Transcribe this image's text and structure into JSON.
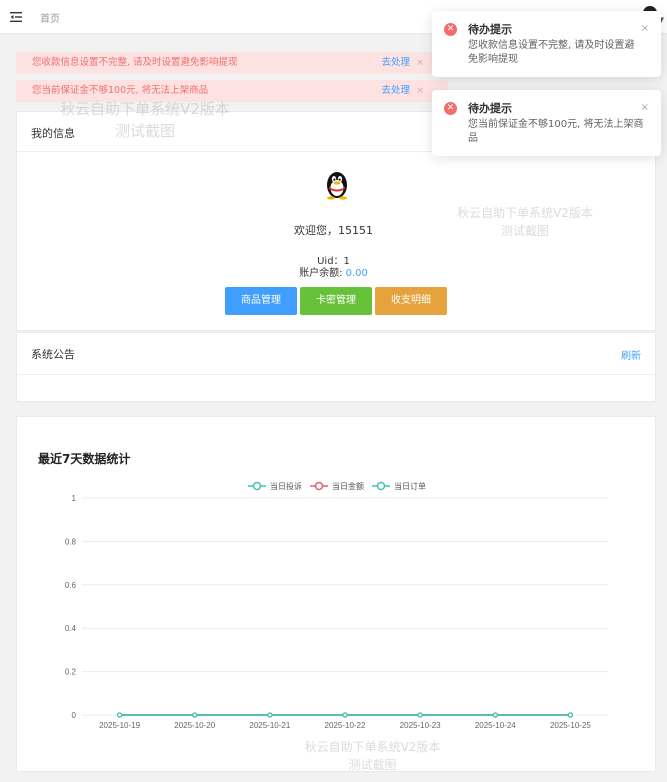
{
  "header": {
    "breadcrumb": "首页"
  },
  "alerts": [
    {
      "text": "您收款信息设置不完整, 请及时设置避免影响提现",
      "action": "去处理",
      "close": "×"
    },
    {
      "text": "您当前保证金不够100元, 将无法上架商品",
      "action": "去处理",
      "close": "×"
    }
  ],
  "my_info": {
    "title": "我的信息",
    "welcome": "欢迎您，15151",
    "uid": "Uid：1",
    "balance_label": "账户余额: ",
    "balance_value": "0.00",
    "buttons": [
      "商品管理",
      "卡密管理",
      "收支明细"
    ]
  },
  "notice": {
    "title": "系统公告",
    "refresh": "刷新"
  },
  "stats": {
    "title": "最近7天数据统计"
  },
  "toasts": [
    {
      "title": "待办提示",
      "message": "您收款信息设置不完整, 请及时设置避免影响提现",
      "close": "×"
    },
    {
      "title": "待办提示",
      "message": "您当前保证金不够100元, 将无法上架商品",
      "close": "×"
    }
  ],
  "watermark": {
    "line1": "秋云自助下单系统V2版本",
    "line2": "测试截图"
  },
  "colors": {
    "primary": "#409eff",
    "success": "#67c23a",
    "warning": "#e6a23c",
    "danger": "#f56c6c"
  },
  "chart_data": {
    "type": "line",
    "categories": [
      "2025-10-19",
      "2025-10-20",
      "2025-10-21",
      "2025-10-22",
      "2025-10-23",
      "2025-10-24",
      "2025-10-25"
    ],
    "series": [
      {
        "name": "当日投诉",
        "values": [
          0,
          0,
          0,
          0,
          0,
          0,
          0
        ],
        "color": "#3ec4b3"
      },
      {
        "name": "当日金额",
        "values": [
          0,
          0,
          0,
          0,
          0,
          0,
          0
        ],
        "color": "#e0616a"
      },
      {
        "name": "当日订单",
        "values": [
          0,
          0,
          0,
          0,
          0,
          0,
          0
        ],
        "color": "#3ec4b3"
      }
    ],
    "y_ticks": [
      "0",
      "0.2",
      "0.4",
      "0.6",
      "0.8",
      "1"
    ],
    "ylim": [
      0,
      1
    ],
    "grid": true,
    "legend": "top-center"
  }
}
